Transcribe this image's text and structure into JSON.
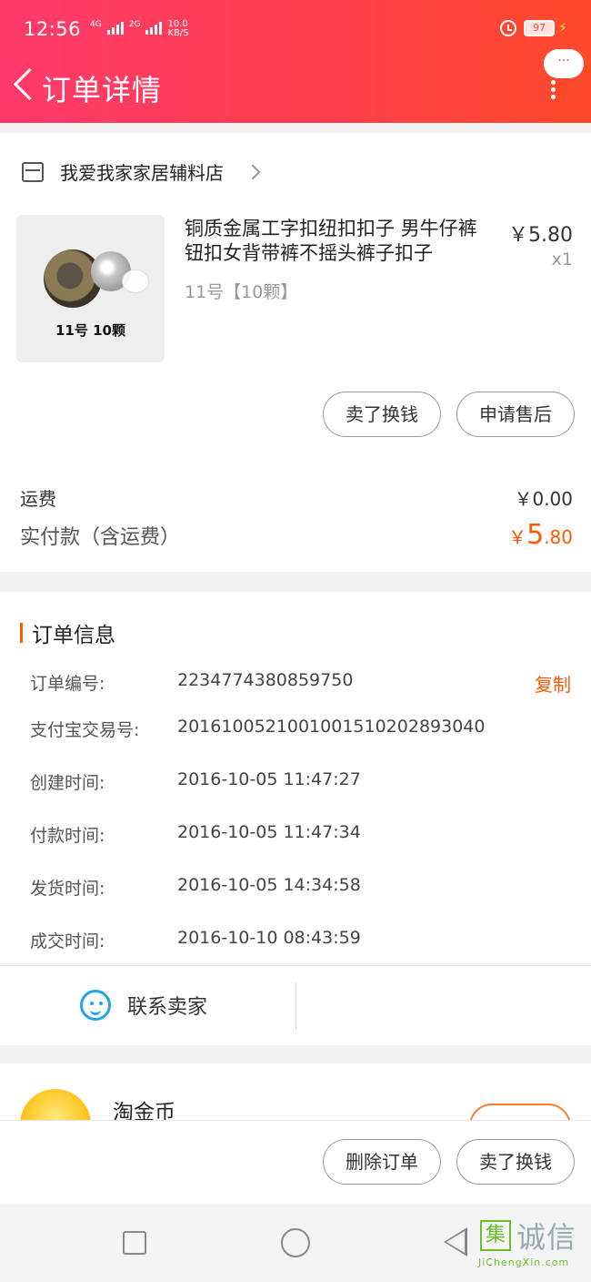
{
  "status_bar": {
    "time": "12:56",
    "net1": "4G",
    "net2": "2G",
    "speed": "10.0\nKB/S",
    "battery": "97"
  },
  "nav": {
    "title": "订单详情",
    "more_label": "···"
  },
  "shop": {
    "name": "我爱我家家居辅料店"
  },
  "product": {
    "image_label": "11号 10颗",
    "title": "铜质金属工字扣纽扣扣子 男牛仔裤钮扣女背带裤不摇头裤子扣子",
    "sku": "11号【10颗】",
    "price": "￥5.80",
    "qty": "x1",
    "btn_sell": "卖了换钱",
    "btn_after_sale": "申请售后"
  },
  "fees": {
    "shipping_label": "运费",
    "shipping_value": "￥0.00",
    "paid_label": "实付款（含运费）",
    "paid_currency": "￥",
    "paid_int": "5",
    "paid_dec": ".80"
  },
  "order_info": {
    "title": "订单信息",
    "copy_label": "复制",
    "rows": [
      {
        "label": "订单编号:",
        "value": "2234774380859750"
      },
      {
        "label": "支付宝交易号:",
        "value": "2016100521001001510202893040"
      },
      {
        "label": "创建时间:",
        "value": "2016-10-05 11:47:27"
      },
      {
        "label": "付款时间:",
        "value": "2016-10-05 11:47:34"
      },
      {
        "label": "发货时间:",
        "value": "2016-10-05 14:34:58"
      },
      {
        "label": "成交时间:",
        "value": "2016-10-10 08:43:59"
      }
    ]
  },
  "contact": {
    "label": "联系卖家"
  },
  "coin": {
    "label": "淘金币"
  },
  "actions": {
    "delete_label": "删除订单",
    "sell_label": "卖了换钱"
  },
  "watermark": {
    "box": "集",
    "text": "诚信",
    "url": "JiChengXin.com"
  },
  "colors": {
    "accent": "#ff5a00",
    "header_start": "#ff3a6b",
    "header_end": "#ff4a2a",
    "wangwang": "#1ea6e6"
  }
}
